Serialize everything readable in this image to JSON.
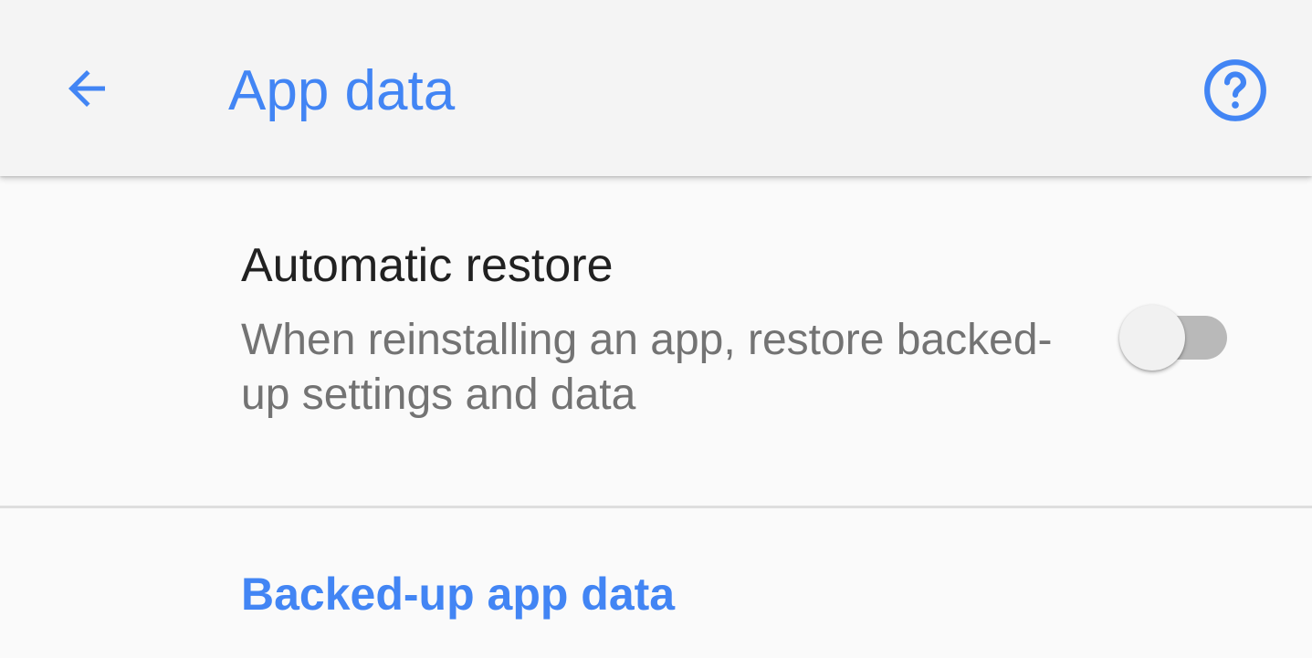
{
  "toolbar": {
    "title": "App data",
    "back_icon": "arrow-back-icon",
    "help_icon": "help-circle-icon"
  },
  "automatic_restore": {
    "title": "Automatic restore",
    "summary": "When reinstalling an app, restore backed-up settings and data",
    "enabled": false
  },
  "backed_up_link": {
    "label": "Backed-up app data"
  },
  "colors": {
    "accent": "#4285f4",
    "toolbar_bg": "#f4f4f4",
    "page_bg": "#fafafa",
    "title_text": "#212121",
    "summary_text": "#737373",
    "switch_track_off": "#b9b9b9",
    "switch_thumb_off": "#f1f1f1"
  }
}
